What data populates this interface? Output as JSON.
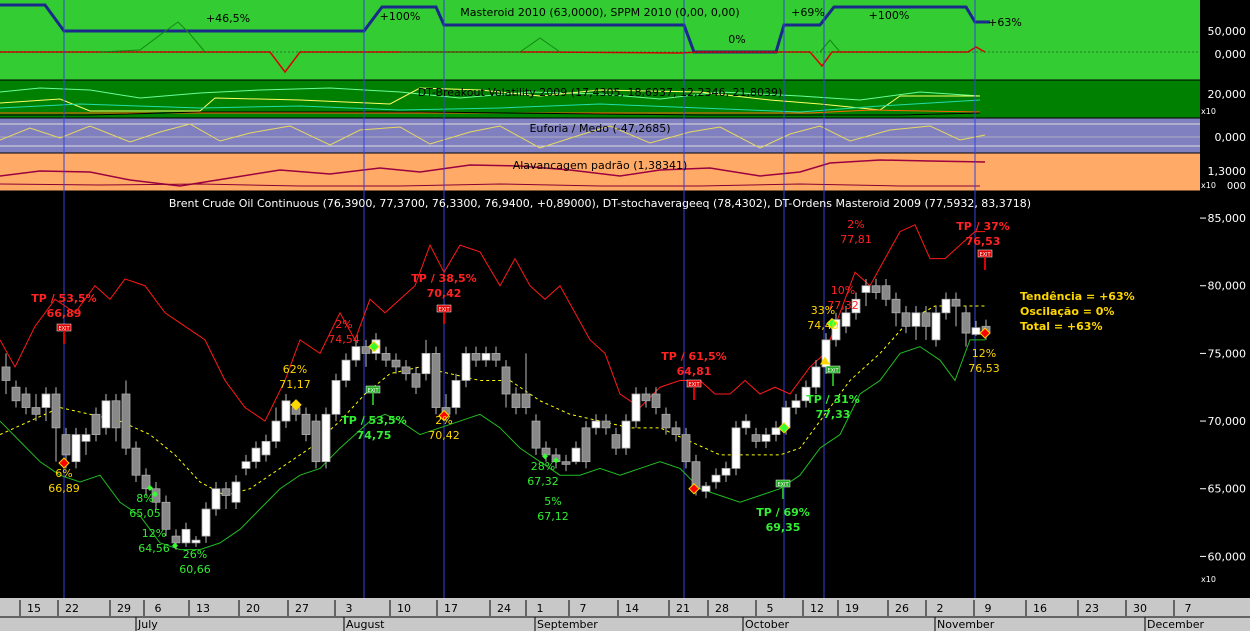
{
  "colors": {
    "p1_bg": "#33cc33",
    "p2_bg": "#008000",
    "p3_bg": "#8080c0",
    "p4_bg": "#ffaa66",
    "main_bg": "#000000",
    "axis_bg": "#c8c8c8",
    "blue_line": "#1a2a8a",
    "red": "#ff1a1a",
    "green": "#22bb22",
    "yellow": "#ffff00"
  },
  "panels": {
    "masteroid_title": "Masteroid 2010 (63,0000), SPPM 2010 (0,00, 0,00)",
    "masteroid_segments": [
      "+46,5%",
      "+100%",
      "0%",
      "+69%",
      "+100%",
      "+63%"
    ],
    "masteroid_ticks": [
      "50,000",
      "0,000"
    ],
    "breakout_title": "DT-Breakout Volatility 2009 (17,4305, 18,6937, 12,2346, 21,8039)",
    "breakout_ticks": [
      "20,000"
    ],
    "euforia_title": "Euforia / Medo (-47,2685)",
    "euforia_ticks": [
      "0,000"
    ],
    "alav_title": "Alavancagem padrão (1,38341)",
    "alav_ticks": [
      "1,3000",
      "000"
    ],
    "x10": "x10"
  },
  "main": {
    "title": "Brent Crude Oil Continuous (76,3900, 77,3700, 76,3300, 76,9400, +0,89000), DT-stochaveragееq (78,4302), DT-Ordens Masteroid 2009 (77,5932, 83,3718)",
    "summary": [
      "Tendência = +63%",
      "Oscilação = 0%",
      "Total = +63%"
    ],
    "red_annotations": [
      {
        "t1": "TP / 53,5%",
        "t2": "66,89"
      },
      {
        "t1": "2%",
        "t2": "74,54"
      },
      {
        "t1": "TP / 38,5%",
        "t2": "70,42"
      },
      {
        "t1": "TP / 61,5%",
        "t2": "64,81"
      },
      {
        "t1": "10%",
        "t2": "77,32"
      },
      {
        "t1": "2%",
        "t2": "77,81"
      },
      {
        "t1": "TP / 37%",
        "t2": "76,53"
      }
    ],
    "yellow_annotations": [
      {
        "t1": "6%",
        "t2": "66,89"
      },
      {
        "t1": "62%",
        "t2": "71,17"
      },
      {
        "t1": "2%",
        "t2": "70,42"
      },
      {
        "t1": "33%",
        "t2": "74,40"
      },
      {
        "t1": "12%",
        "t2": "76,53"
      }
    ],
    "green_annotations": [
      {
        "t1": "8%",
        "t2": "65,05"
      },
      {
        "t1": "12%",
        "t2": "64,56"
      },
      {
        "t1": "26%",
        "t2": "60,66"
      },
      {
        "t1": "TP / 53,5%",
        "t2": "74,75"
      },
      {
        "t1": "28%",
        "t2": "67,32"
      },
      {
        "t1": "5%",
        "t2": "67,12"
      },
      {
        "t1": "TP / 69%",
        "t2": "69,35"
      },
      {
        "t1": "TP / 31%",
        "t2": "77,33"
      }
    ],
    "exit_label": "EXIT",
    "x10": "x10"
  },
  "x_axis": {
    "days": [
      "15",
      "22",
      "29",
      "6",
      "13",
      "20",
      "27",
      "3",
      "10",
      "17",
      "24",
      "1",
      "7",
      "14",
      "21",
      "28",
      "5",
      "12",
      "19",
      "26",
      "2",
      "9",
      "16",
      "23",
      "30",
      "7"
    ],
    "months": [
      "July",
      "August",
      "September",
      "October",
      "November",
      "December"
    ]
  },
  "chart_data": {
    "type": "candlestick",
    "title": "Brent Crude Oil Continuous (76,3900, 77,3700, 76,3300, 76,9400, +0,89000)",
    "ylim": [
      57,
      87
    ],
    "y_ticks": [
      60,
      65,
      70,
      75,
      80,
      85
    ],
    "y_tick_labels": [
      "60,000",
      "65,000",
      "70,000",
      "75,000",
      "80,000",
      "85,000"
    ],
    "x_tick_labels": [
      "15",
      "22",
      "29",
      "6",
      "13",
      "20",
      "27",
      "3",
      "10",
      "17",
      "24",
      "1",
      "7",
      "14",
      "21",
      "28",
      "5",
      "12",
      "19",
      "26",
      "2",
      "9",
      "16",
      "23",
      "30",
      "7"
    ],
    "months": [
      "July",
      "August",
      "September",
      "October",
      "November",
      "December"
    ],
    "last_bar": {
      "open": 76.39,
      "high": 77.37,
      "low": 76.33,
      "close": 76.94,
      "change": 0.89
    }
  }
}
